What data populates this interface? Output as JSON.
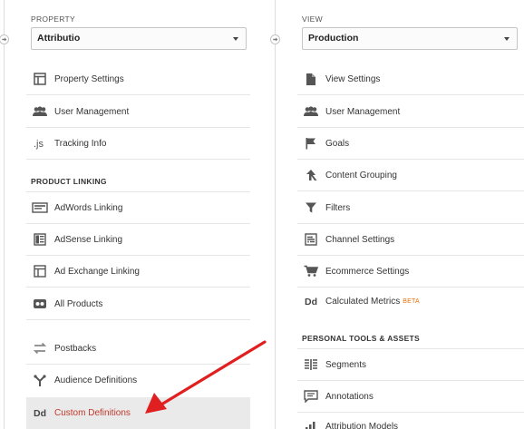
{
  "property": {
    "header": "PROPERTY",
    "selected": "Attributio",
    "items": [
      {
        "label": "Property Settings",
        "icon": "property-settings-icon"
      },
      {
        "label": "User Management",
        "icon": "users-icon"
      },
      {
        "label": "Tracking Info",
        "icon": "js-icon"
      }
    ],
    "product_linking_header": "PRODUCT LINKING",
    "linking_items": [
      {
        "label": "AdWords Linking",
        "icon": "adwords-icon"
      },
      {
        "label": "AdSense Linking",
        "icon": "adsense-icon"
      },
      {
        "label": "Ad Exchange Linking",
        "icon": "ad-exchange-icon"
      },
      {
        "label": "All Products",
        "icon": "all-products-icon"
      }
    ],
    "other_items": [
      {
        "label": "Postbacks",
        "icon": "postbacks-icon"
      },
      {
        "label": "Audience Definitions",
        "icon": "audience-icon"
      },
      {
        "label": "Custom Definitions",
        "icon": "dd-icon",
        "icon_text": "Dd",
        "active": true
      }
    ]
  },
  "view": {
    "header": "VIEW",
    "selected": "Production",
    "items": [
      {
        "label": "View Settings",
        "icon": "document-icon"
      },
      {
        "label": "User Management",
        "icon": "users-icon"
      },
      {
        "label": "Goals",
        "icon": "flag-icon"
      },
      {
        "label": "Content Grouping",
        "icon": "content-grouping-icon"
      },
      {
        "label": "Filters",
        "icon": "filter-icon"
      },
      {
        "label": "Channel Settings",
        "icon": "channel-settings-icon"
      },
      {
        "label": "Ecommerce Settings",
        "icon": "cart-icon"
      },
      {
        "label": "Calculated Metrics",
        "icon": "dd-icon",
        "icon_text": "Dd",
        "badge": "BETA"
      }
    ],
    "personal_header": "PERSONAL TOOLS & ASSETS",
    "personal_items": [
      {
        "label": "Segments",
        "icon": "segments-icon"
      },
      {
        "label": "Annotations",
        "icon": "annotations-icon"
      },
      {
        "label": "Attribution Models",
        "icon": "attribution-icon"
      }
    ]
  },
  "colors": {
    "active_text": "#c0392b",
    "beta": "#e8710a",
    "arrow": "#e02020"
  }
}
